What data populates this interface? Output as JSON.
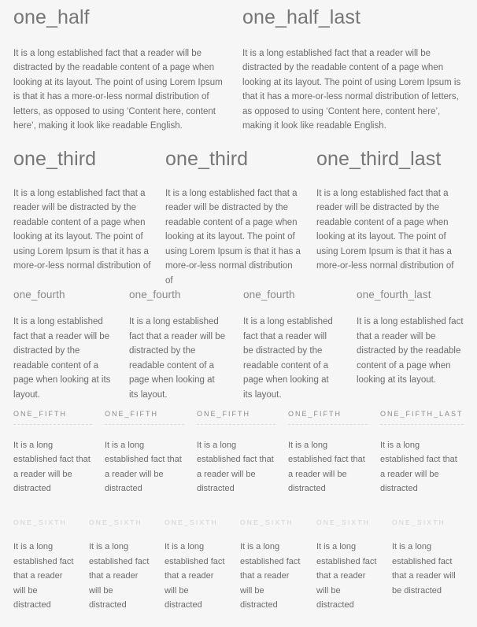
{
  "page": {
    "background_color": "#f6f6f6",
    "heading_color": "#777777",
    "body_color": "#6b6b6b",
    "faint_heading_color": "#d2d2d2",
    "dashed_rule_color": "#dcdcdc"
  },
  "sections": {
    "half": {
      "columns": [
        {
          "heading": "one_half",
          "body": "It is a long established fact that a reader will be distracted by the readable content of a page when looking at its layout. The point of using Lorem Ipsum is that it has a more-or-less normal distribution of letters, as opposed to using ‘Content here, content here’, making it look like readable English."
        },
        {
          "heading": "one_half_last",
          "body": "It is a long established fact that a reader will be distracted by the readable content of a page when looking at its layout. The point of using Lorem Ipsum is that it has a more-or-less normal distribution of letters, as opposed to using ‘Content here, content here’, making it look like readable English."
        }
      ]
    },
    "third": {
      "columns": [
        {
          "heading": "one_third",
          "body": "It is a long established fact that a reader will be distracted by the readable content of a page when looking at its layout. The point of using Lorem Ipsum is that it has a more-or-less normal distribution of"
        },
        {
          "heading": "one_third",
          "body": "It is a long established fact that a reader will be distracted by the readable content of a page when looking at its layout. The point of using Lorem Ipsum is that it has a more-or-less normal distribution of"
        },
        {
          "heading": "one_third_last",
          "body": "It is a long established fact that a reader will be distracted by the readable content of a page when looking at its layout. The point of using Lorem Ipsum is that it has a more-or-less normal distribution of"
        }
      ]
    },
    "fourth": {
      "columns": [
        {
          "heading": "one_fourth",
          "body": "It is a long established fact that a reader will be distracted by the readable content of a page when looking at its layout."
        },
        {
          "heading": "one_fourth",
          "body": "It is a long established fact that a reader will be distracted by the readable content of a page when looking at its layout."
        },
        {
          "heading": "one_fourth",
          "body": "It is a long established fact that a reader will be distracted by the readable content of a page when looking at its layout."
        },
        {
          "heading": "one_fourth_last",
          "body": "It is a long established fact that a reader will be distracted by the readable content of a page when looking at its layout."
        }
      ]
    },
    "fifth": {
      "columns": [
        {
          "heading": "ONE_FIFTH",
          "body": "It is a long established fact that a reader will be distracted"
        },
        {
          "heading": "ONE_FIFTH",
          "body": "It is a long established fact that a reader will be distracted"
        },
        {
          "heading": "ONE_FIFTH",
          "body": "It is a long established fact that a reader will be distracted"
        },
        {
          "heading": "ONE_FIFTH",
          "body": "It is a long established fact that a reader will be distracted"
        },
        {
          "heading": "ONE_FIFTH_LAST",
          "body": "It is a long established fact that a reader will be distracted"
        }
      ]
    },
    "sixth": {
      "columns": [
        {
          "heading": "ONE_SIXTH",
          "body": "It is a long established fact that a reader will be distracted"
        },
        {
          "heading": "ONE_SIXTH",
          "body": "It is a long established fact that a reader will be distracted"
        },
        {
          "heading": "ONE_SIXTH",
          "body": "It is a long established fact that a reader will be distracted"
        },
        {
          "heading": "ONE_SIXTH",
          "body": "It is a long established fact that a reader will be distracted"
        },
        {
          "heading": "ONE_SIXTH",
          "body": "It is a long established fact that a reader will be distracted"
        },
        {
          "heading": "ONE_SIXTH",
          "body": "It is a long established fact that a reader will be distracted"
        }
      ]
    }
  }
}
